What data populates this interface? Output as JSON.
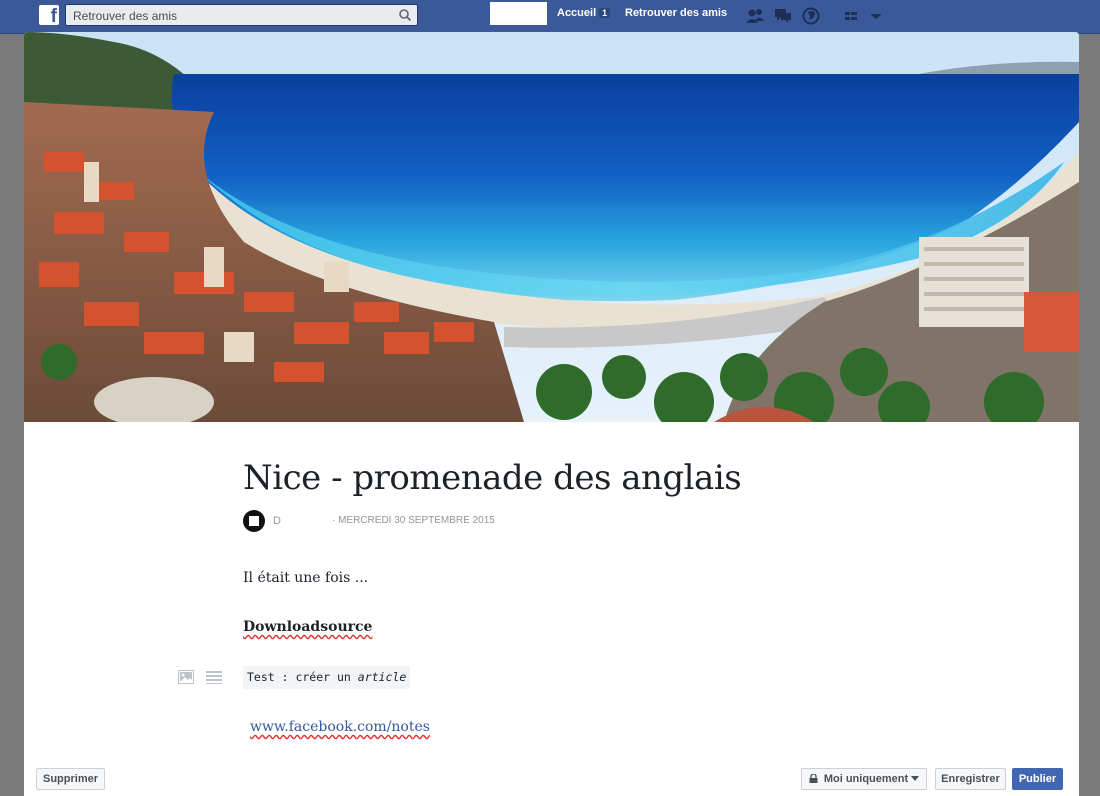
{
  "topbar": {
    "logo_letter": "f",
    "search_placeholder": "Retrouver des amis",
    "home_label": "Accueil",
    "home_badge": "1",
    "find_friends_label": "Retrouver des amis"
  },
  "note": {
    "title": "Nice - promenade des anglais",
    "author": "D",
    "date": "· MERCREDI 30 SEPTEMBRE 2015",
    "paragraph": "Il était une fois ...",
    "heading": "Downloadsource",
    "code_text": "Test : créer un ",
    "code_italic": "article",
    "link": "www.facebook.com/notes"
  },
  "actions": {
    "delete_label": "Supprimer",
    "privacy_label": "Moi uniquement",
    "save_label": "Enregistrer",
    "publish_label": "Publier"
  },
  "colors": {
    "facebook_blue": "#3b5998",
    "publish_blue": "#4267b2",
    "link_blue": "#365899"
  },
  "icons": [
    "facebook-logo-icon",
    "search-icon",
    "friends-icon",
    "messages-icon",
    "globe-icon",
    "menu-icon",
    "image-icon",
    "list-icon",
    "lock-icon",
    "caret-down-icon"
  ]
}
